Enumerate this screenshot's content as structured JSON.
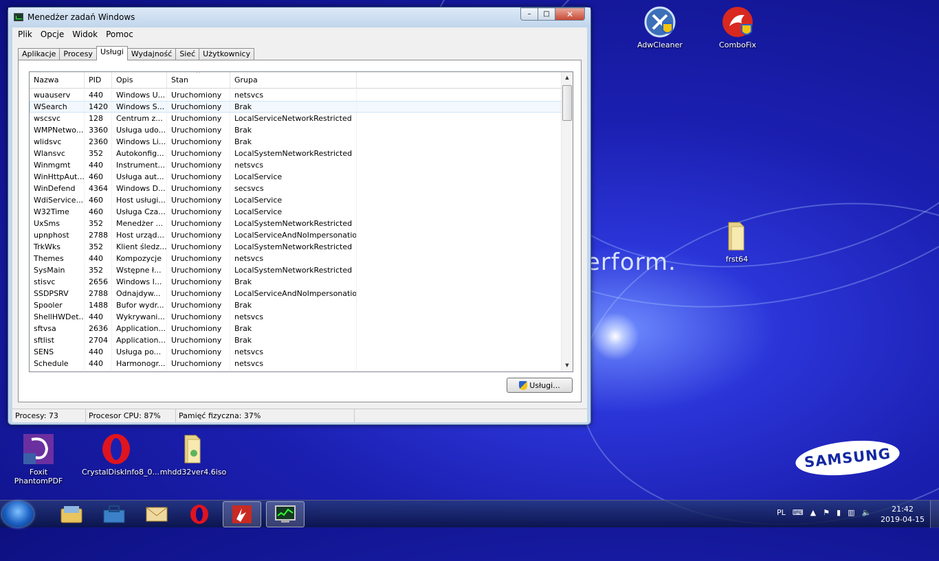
{
  "window": {
    "title": "Menedżer zadań Windows",
    "min_label": "–",
    "max_label": "□",
    "close_label": "✕"
  },
  "menu": [
    "Plik",
    "Opcje",
    "Widok",
    "Pomoc"
  ],
  "tabs": [
    "Aplikacje",
    "Procesy",
    "Usługi",
    "Wydajność",
    "Sieć",
    "Użytkownicy"
  ],
  "active_tab": "Usługi",
  "columns": [
    "Nazwa",
    "PID",
    "Opis",
    "Stan",
    "Grupa"
  ],
  "sort_indicator": "^",
  "rows": [
    [
      "wuauserv",
      "440",
      "Windows U...",
      "Uruchomiony",
      "netsvcs"
    ],
    [
      "WSearch",
      "1420",
      "Windows S...",
      "Uruchomiony",
      "Brak"
    ],
    [
      "wscsvc",
      "128",
      "Centrum z...",
      "Uruchomiony",
      "LocalServiceNetworkRestricted"
    ],
    [
      "WMPNetwo...",
      "3360",
      "Usługa udo...",
      "Uruchomiony",
      "Brak"
    ],
    [
      "wlidsvc",
      "2360",
      "Windows Li...",
      "Uruchomiony",
      "Brak"
    ],
    [
      "Wlansvc",
      "352",
      "Autokonfig...",
      "Uruchomiony",
      "LocalSystemNetworkRestricted"
    ],
    [
      "Winmgmt",
      "440",
      "Instrument...",
      "Uruchomiony",
      "netsvcs"
    ],
    [
      "WinHttpAut...",
      "460",
      "Usługa aut...",
      "Uruchomiony",
      "LocalService"
    ],
    [
      "WinDefend",
      "4364",
      "Windows D...",
      "Uruchomiony",
      "secsvcs"
    ],
    [
      "WdiService...",
      "460",
      "Host usługi...",
      "Uruchomiony",
      "LocalService"
    ],
    [
      "W32Time",
      "460",
      "Usługa Cza...",
      "Uruchomiony",
      "LocalService"
    ],
    [
      "UxSms",
      "352",
      "Menedżer ...",
      "Uruchomiony",
      "LocalSystemNetworkRestricted"
    ],
    [
      "upnphost",
      "2788",
      "Host urząd...",
      "Uruchomiony",
      "LocalServiceAndNoImpersonation"
    ],
    [
      "TrkWks",
      "352",
      "Klient śledz...",
      "Uruchomiony",
      "LocalSystemNetworkRestricted"
    ],
    [
      "Themes",
      "440",
      "Kompozycje",
      "Uruchomiony",
      "netsvcs"
    ],
    [
      "SysMain",
      "352",
      "Wstępne ł...",
      "Uruchomiony",
      "LocalSystemNetworkRestricted"
    ],
    [
      "stisvc",
      "2656",
      "Windows I...",
      "Uruchomiony",
      "Brak"
    ],
    [
      "SSDPSRV",
      "2788",
      "Odnajdyw...",
      "Uruchomiony",
      "LocalServiceAndNoImpersonation"
    ],
    [
      "Spooler",
      "1488",
      "Bufor wydr...",
      "Uruchomiony",
      "Brak"
    ],
    [
      "ShellHWDet...",
      "440",
      "Wykrywani...",
      "Uruchomiony",
      "netsvcs"
    ],
    [
      "sftvsa",
      "2636",
      "Application...",
      "Uruchomiony",
      "Brak"
    ],
    [
      "sftlist",
      "2704",
      "Application...",
      "Uruchomiony",
      "Brak"
    ],
    [
      "SENS",
      "440",
      "Usługa po...",
      "Uruchomiony",
      "netsvcs"
    ],
    [
      "Schedule",
      "440",
      "Harmonogr...",
      "Uruchomiony",
      "netsvcs"
    ]
  ],
  "selected_row": 1,
  "services_button": "Usługi...",
  "status": {
    "processes": "Procesy: 73",
    "cpu": "Procesor CPU: 87%",
    "memory": "Pamięć fizyczna: 37%"
  },
  "desktop": {
    "icons": [
      {
        "label": "AdwCleaner",
        "icon": "adwcleaner-icon"
      },
      {
        "label": "ComboFix",
        "icon": "combofix-icon"
      },
      {
        "label": "frst64",
        "icon": "folder-icon"
      },
      {
        "label": "Foxit PhantomPDF",
        "icon": "pdf-icon"
      },
      {
        "label": "CrystalDiskInfo8_0...",
        "icon": "opera-icon"
      },
      {
        "label": "mhdd32ver4.6iso",
        "icon": "folder-icon"
      }
    ],
    "wallpaper_text": "erform.",
    "brand": "SAMSUNG"
  },
  "taskbar": {
    "lang": "PL",
    "time": "21:42",
    "date": "2019-04-15"
  },
  "colors": {
    "accent": "#2b35d8",
    "close_button": "#c74a34",
    "selection": "#cde3f5"
  }
}
